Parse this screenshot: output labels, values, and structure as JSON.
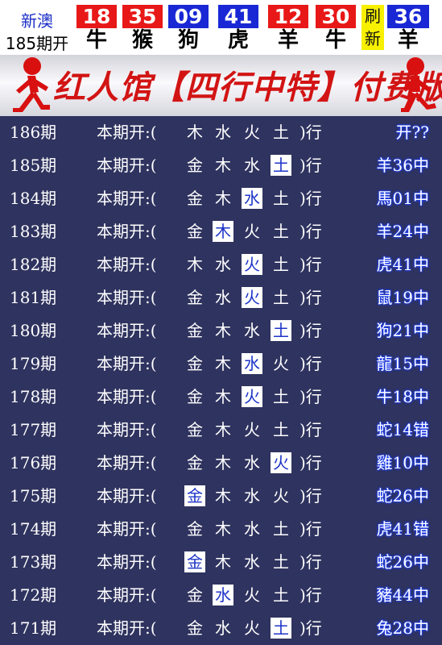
{
  "header": {
    "label_line1": "新澳",
    "label_line2": "185期开",
    "balls": [
      {
        "number": "18",
        "zodiac": "牛",
        "color": "red"
      },
      {
        "number": "35",
        "zodiac": "猴",
        "color": "red"
      },
      {
        "number": "09",
        "zodiac": "狗",
        "color": "blue"
      },
      {
        "number": "41",
        "zodiac": "虎",
        "color": "blue"
      },
      {
        "number": "12",
        "zodiac": "羊",
        "color": "red"
      },
      {
        "number": "30",
        "zodiac": "牛",
        "color": "red"
      },
      {
        "number": "36",
        "zodiac": "羊",
        "color": "blue"
      }
    ],
    "refresh_top": "刷",
    "refresh_bottom": "新",
    "colors": {
      "red": "#e81818",
      "blue": "#1928d4",
      "refresh_bg": "#f7f000"
    }
  },
  "banner": {
    "title": "红人馆【四行中特】付费版",
    "icon": "running-man-icon"
  },
  "table": {
    "benqi_label": "本期开:(",
    "close_label": ")行",
    "bg_color": "#2f335f",
    "rows": [
      {
        "period": "186期",
        "elements": [
          "木",
          "水",
          "火",
          "土"
        ],
        "hit": -1,
        "result": "开??"
      },
      {
        "period": "185期",
        "elements": [
          "金",
          "木",
          "水",
          "土"
        ],
        "hit": 3,
        "result": "羊36中"
      },
      {
        "period": "184期",
        "elements": [
          "金",
          "木",
          "水",
          "土"
        ],
        "hit": 2,
        "result": "馬01中"
      },
      {
        "period": "183期",
        "elements": [
          "金",
          "木",
          "火",
          "土"
        ],
        "hit": 1,
        "result": "羊24中"
      },
      {
        "period": "182期",
        "elements": [
          "木",
          "水",
          "火",
          "土"
        ],
        "hit": 2,
        "result": "虎41中"
      },
      {
        "period": "181期",
        "elements": [
          "金",
          "水",
          "火",
          "土"
        ],
        "hit": 2,
        "result": "鼠19中"
      },
      {
        "period": "180期",
        "elements": [
          "金",
          "木",
          "水",
          "土"
        ],
        "hit": 3,
        "result": "狗21中"
      },
      {
        "period": "179期",
        "elements": [
          "金",
          "木",
          "水",
          "火"
        ],
        "hit": 2,
        "result": "龍15中"
      },
      {
        "period": "178期",
        "elements": [
          "金",
          "木",
          "火",
          "土"
        ],
        "hit": 2,
        "result": "牛18中"
      },
      {
        "period": "177期",
        "elements": [
          "金",
          "木",
          "火",
          "土"
        ],
        "hit": -1,
        "result": "蛇14错"
      },
      {
        "period": "176期",
        "elements": [
          "金",
          "木",
          "水",
          "火"
        ],
        "hit": 3,
        "result": "雞10中"
      },
      {
        "period": "175期",
        "elements": [
          "金",
          "木",
          "水",
          "火"
        ],
        "hit": 0,
        "result": "蛇26中"
      },
      {
        "period": "174期",
        "elements": [
          "金",
          "木",
          "水",
          "土"
        ],
        "hit": -1,
        "result": "虎41错"
      },
      {
        "period": "173期",
        "elements": [
          "金",
          "木",
          "水",
          "土"
        ],
        "hit": 0,
        "result": "蛇26中"
      },
      {
        "period": "172期",
        "elements": [
          "金",
          "水",
          "火",
          "土"
        ],
        "hit": 1,
        "result": "豬44中"
      },
      {
        "period": "171期",
        "elements": [
          "金",
          "水",
          "火",
          "土"
        ],
        "hit": 3,
        "result": "兔28中"
      }
    ]
  }
}
